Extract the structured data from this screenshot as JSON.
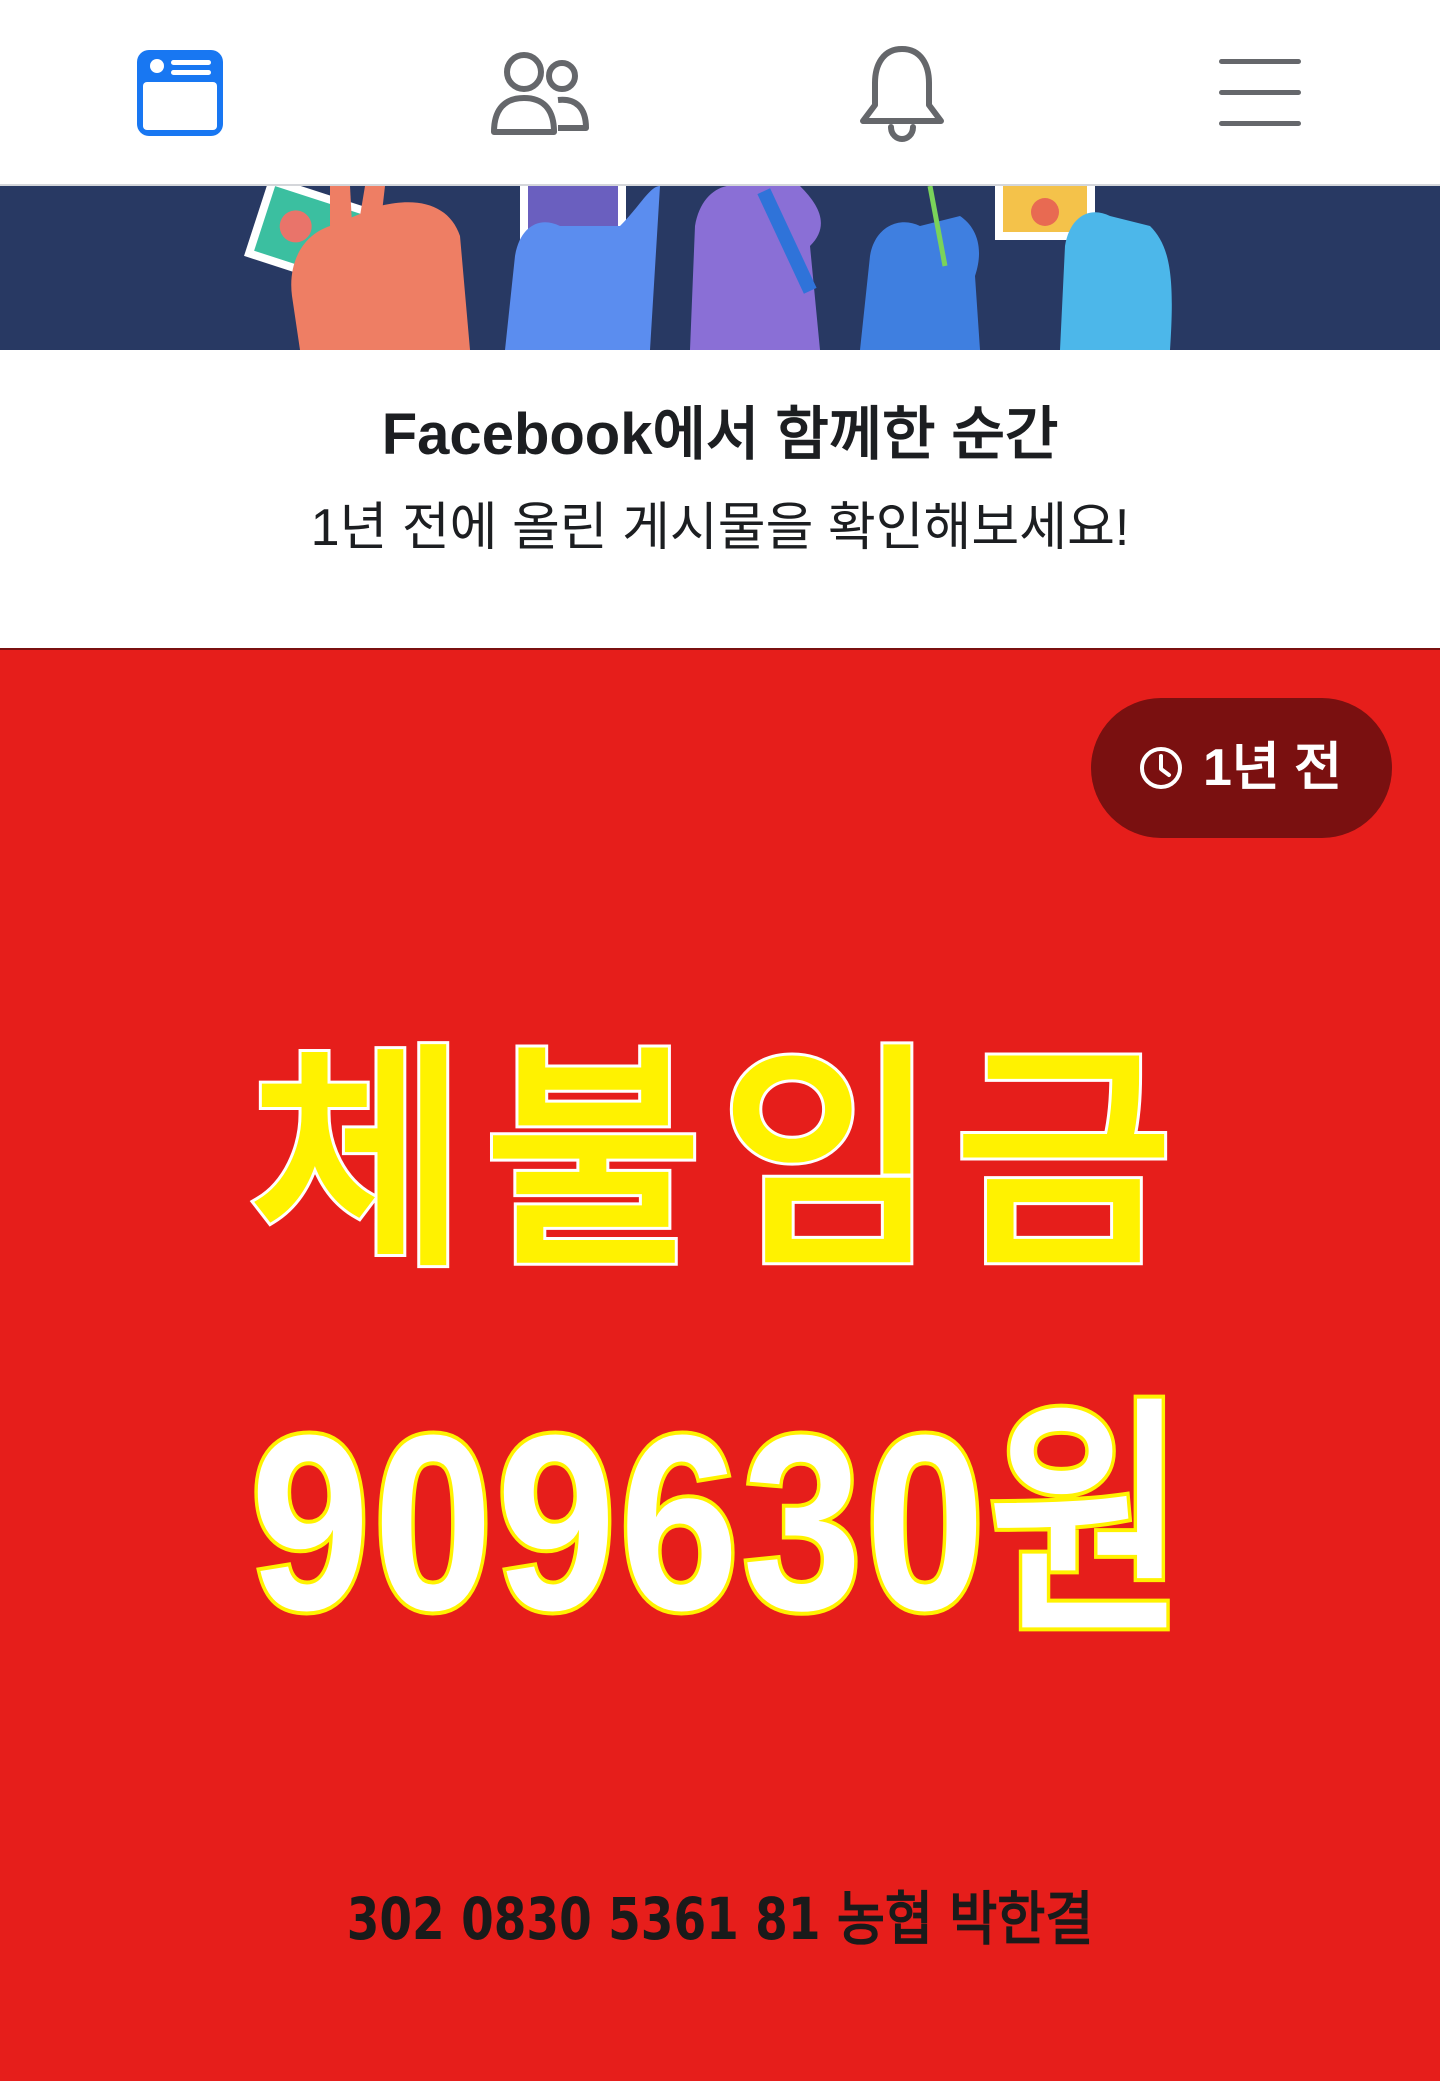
{
  "nav": {
    "items": [
      {
        "icon": "news-feed-icon",
        "active": true
      },
      {
        "icon": "friends-icon",
        "active": false
      },
      {
        "icon": "bell-icon",
        "active": false
      },
      {
        "icon": "menu-icon",
        "active": false
      }
    ],
    "active_color": "#1877f2",
    "inactive_color": "#65676b"
  },
  "memory": {
    "title": "Facebook에서 함께한 순간",
    "subtitle": "1년 전에 올린 게시물을 확인해보세요!"
  },
  "poster": {
    "time_badge": "1년 전",
    "headline": "체불임금",
    "amount": "909630원",
    "account_line": "302 0830 5361 81 농협 박한결",
    "background_color": "#e61e1b",
    "headline_color": "#fff200"
  }
}
